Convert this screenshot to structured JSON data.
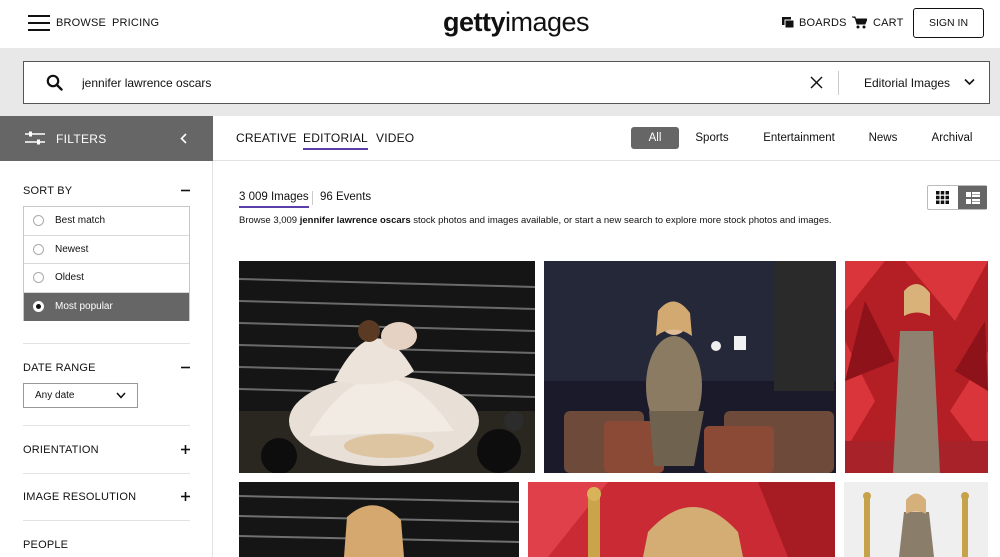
{
  "nav": {
    "browse": "BROWSE",
    "pricing": "PRICING",
    "logo_bold": "getty",
    "logo_light": "images",
    "boards": "BOARDS",
    "cart": "CART",
    "sign_in": "SIGN IN"
  },
  "search": {
    "query": "jennifer lawrence oscars",
    "scope": "Editorial Images"
  },
  "filters": {
    "title": "FILTERS",
    "sort_by": {
      "title": "SORT BY",
      "options": [
        "Best match",
        "Newest",
        "Oldest",
        "Most popular"
      ],
      "selected": "Most popular"
    },
    "date_range": {
      "title": "DATE RANGE",
      "value": "Any date"
    },
    "orientation": "ORIENTATION",
    "image_resolution": "IMAGE RESOLUTION",
    "people": "PEOPLE"
  },
  "type_tabs": [
    "CREATIVE",
    "EDITORIAL",
    "VIDEO"
  ],
  "active_type_tab": "EDITORIAL",
  "categories": [
    "All",
    "Sports",
    "Entertainment",
    "News",
    "Archival"
  ],
  "active_category": "All",
  "results": {
    "images_count": "3 009 Images",
    "events_count": "96 Events",
    "browse_prefix": "Browse 3,009 ",
    "browse_query": "jennifer lawrence oscars",
    "browse_suffix": " stock photos and images available, or start a new search to explore more stock photos and images."
  },
  "icons": {
    "menu": "hamburger-menu-icon",
    "boards": "boards-icon",
    "cart": "shopping-cart-icon",
    "search": "search-icon",
    "clear": "close-icon",
    "filters": "sliders-icon",
    "grid_view": "grid-view-icon",
    "mosaic_view": "mosaic-view-icon"
  },
  "colors": {
    "accent_underline": "#5b3ea8",
    "active_gray": "#666666",
    "search_band": "#e8e8e8"
  }
}
